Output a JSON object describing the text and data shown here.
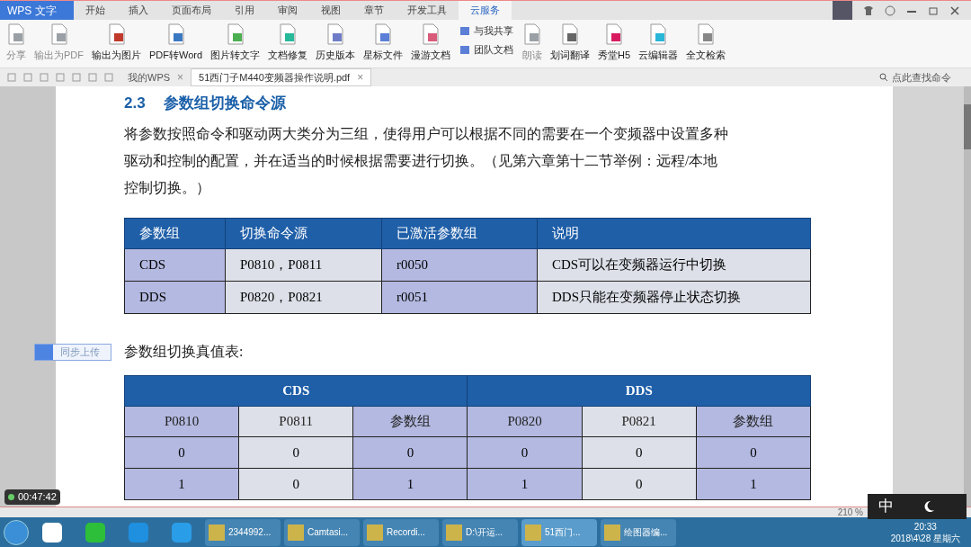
{
  "app_button": "WPS 文字",
  "menu_tabs": [
    {
      "label": "开始",
      "selected": false
    },
    {
      "label": "插入",
      "selected": false
    },
    {
      "label": "页面布局",
      "selected": false
    },
    {
      "label": "引用",
      "selected": false
    },
    {
      "label": "审阅",
      "selected": false
    },
    {
      "label": "视图",
      "selected": false
    },
    {
      "label": "章节",
      "selected": false
    },
    {
      "label": "开发工具",
      "selected": false
    },
    {
      "label": "云服务",
      "selected": true
    }
  ],
  "ribbon": [
    {
      "label": "分享",
      "disabled": true,
      "color": "#9aa0a6"
    },
    {
      "label": "输出为PDF",
      "disabled": true,
      "color": "#9aa0a6"
    },
    {
      "label": "输出为图片",
      "disabled": false,
      "color": "#c0392b"
    },
    {
      "label": "PDF转Word",
      "disabled": false,
      "color": "#3a78c2"
    },
    {
      "label": "图片转文字",
      "disabled": false,
      "color": "#4caf50"
    },
    {
      "label": "文档修复",
      "disabled": false,
      "color": "#26b99a"
    },
    {
      "label": "历史版本",
      "disabled": false,
      "color": "#6f7dc8"
    },
    {
      "label": "星标文件",
      "disabled": false,
      "color": "#5b7fd6"
    },
    {
      "label": "漫游文档",
      "disabled": false,
      "color": "#d95b7a"
    },
    {
      "label": "与我共享",
      "disabled": false,
      "color": "#5b7fd6",
      "kind": "small"
    },
    {
      "label": "团队文档",
      "disabled": false,
      "color": "#5b7fd6",
      "kind": "small"
    },
    {
      "label": "朗读",
      "disabled": true,
      "color": "#9aa0a6"
    },
    {
      "label": "划词翻译",
      "disabled": false,
      "color": "#666666"
    },
    {
      "label": "秀堂H5",
      "disabled": false,
      "color": "#d81b60"
    },
    {
      "label": "云编辑器",
      "disabled": false,
      "color": "#29b6d8"
    },
    {
      "label": "全文检索",
      "disabled": false,
      "color": "#888888"
    }
  ],
  "doc_tabs": [
    {
      "label": "我的WPS",
      "selected": false,
      "close": "×"
    },
    {
      "label": "51西门子M440变频器操作说明.pdf",
      "selected": true,
      "close": "×"
    }
  ],
  "command_search": {
    "placeholder": "点此查找命令"
  },
  "document": {
    "heading_number": "2.3",
    "heading": "参数组切换命令源",
    "paragraph": [
      "将参数按照命令和驱动两大类分为三组，使得用户可以根据不同的需要在一个变频器中设置多种",
      "驱动和控制的配置，并在适当的时候根据需要进行切换。（见第六章第十二节举例：远程/本地",
      "控制切换。）"
    ],
    "table1": {
      "columns": [
        "参数组",
        "切换命令源",
        "已激活参数组",
        "说明"
      ],
      "rows": [
        [
          "CDS",
          "P0810，P0811",
          "r0050",
          "CDS可以在变频器运行中切换"
        ],
        [
          "DDS",
          "P0820，P0821",
          "r0051",
          "DDS只能在变频器停止状态切换"
        ]
      ]
    },
    "caption": "参数组切换真值表:",
    "table2": {
      "groups": [
        "CDS",
        "DDS"
      ],
      "columns": [
        "P0810",
        "P0811",
        "参数组",
        "P0820",
        "P0821",
        "参数组"
      ],
      "rows": [
        [
          "0",
          "0",
          "0",
          "0",
          "0",
          "0"
        ],
        [
          "1",
          "0",
          "1",
          "1",
          "0",
          "1"
        ]
      ]
    }
  },
  "upload_button": "同步上传",
  "timer": "00:47:42",
  "zoom": "210 %",
  "ime": "中",
  "taskbar": [
    {
      "label": "2344992...",
      "selected": false
    },
    {
      "label": "Camtasi...",
      "selected": false
    },
    {
      "label": "Recordi...",
      "selected": false
    },
    {
      "label": "D:\\开运...",
      "selected": false
    },
    {
      "label": "51西门...",
      "selected": true
    },
    {
      "label": "绘图器编...",
      "selected": false
    }
  ],
  "clock": {
    "time": "20:33",
    "date": "2018\\4\\28 星期六"
  }
}
